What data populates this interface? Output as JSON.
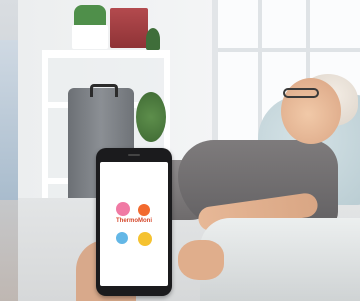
{
  "app": {
    "logo_text": "ThermoMoni"
  },
  "colors": {
    "dot_pink": "#f07aa4",
    "dot_orange": "#f26a2e",
    "dot_blue": "#63b7e6",
    "dot_yellow": "#f5c230",
    "logo_text": "#d64a2e"
  },
  "icons": [
    "app-logo-icon"
  ]
}
